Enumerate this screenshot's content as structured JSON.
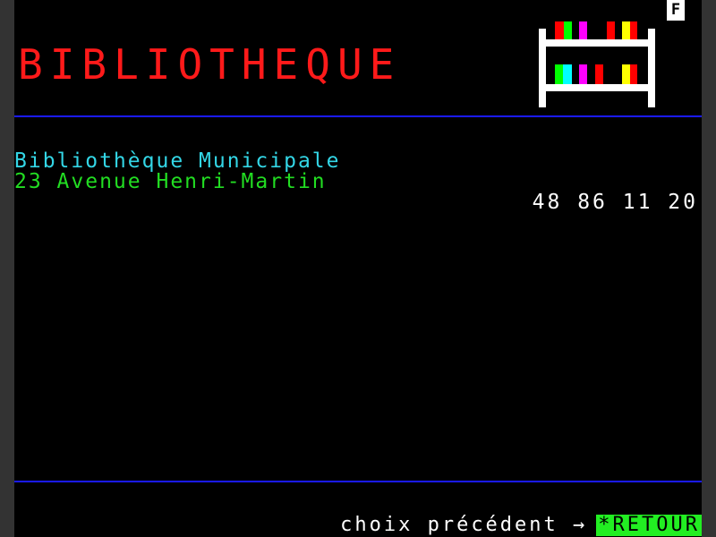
{
  "header": {
    "title": "BIBLIOTHEQUE",
    "badge": "F"
  },
  "library": {
    "name": "Bibliothèque Municipale",
    "address": "23 Avenue Henri-Martin",
    "phone": "48 86 11 20"
  },
  "footer": {
    "prompt": "choix précédent →",
    "button": "*RETOUR"
  },
  "shelf_icon": {
    "name": "bookshelf-icon",
    "book_colors": [
      "#ff0000",
      "#00ff00",
      "#ff00ff",
      "#ff0000",
      "#ffff00",
      "#00ffff"
    ]
  },
  "colors": {
    "background": "#000000",
    "title": "#ff1a1a",
    "name_text": "#33d6e6",
    "address_text": "#22dd22",
    "phone_text": "#ffffff",
    "divider": "#1a1aff",
    "button_bg": "#22ee22",
    "prompt_text": "#ffffff"
  }
}
